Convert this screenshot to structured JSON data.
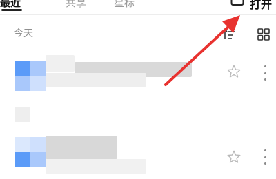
{
  "tabs": [
    {
      "label": "最近",
      "active": true
    },
    {
      "label": "共享",
      "active": false
    },
    {
      "label": "星标",
      "active": false
    }
  ],
  "open_button": {
    "label": "打开",
    "icon": "folder-icon"
  },
  "section": {
    "title": "今天"
  },
  "toolbar": {
    "sort_icon": "sort-filter-icon",
    "grid_icon": "grid-view-icon"
  },
  "colors": {
    "accent_blue": "#5b9bf8",
    "light_blue": "#a9c8fb",
    "annotation_red": "#e8322f"
  }
}
